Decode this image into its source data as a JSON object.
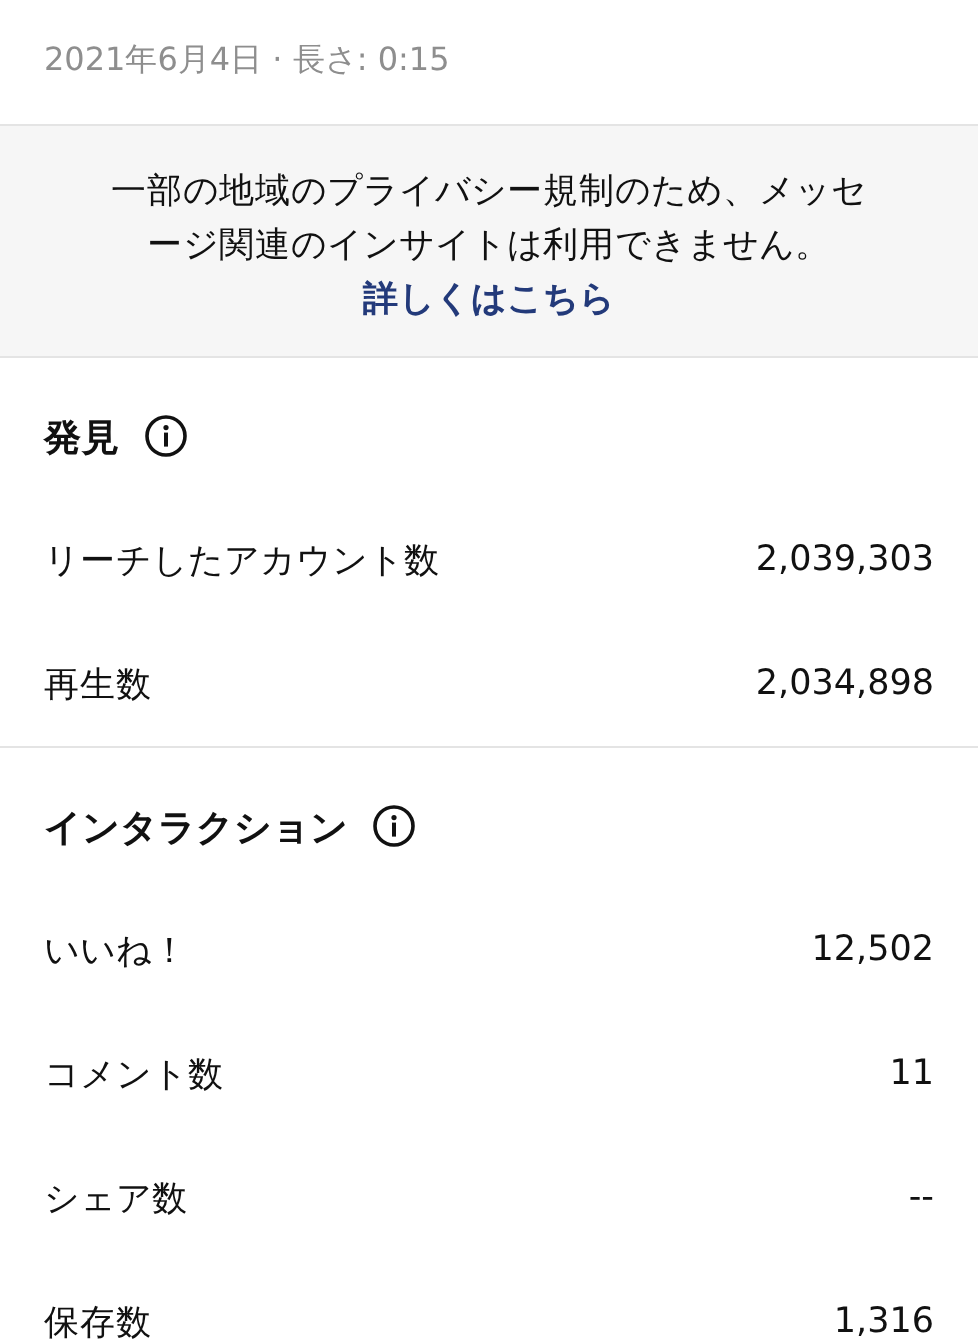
{
  "date_line": "2021年6月4日 · 長さ: 0:15",
  "notice": {
    "text": "一部の地域のプライバシー規制のため、メッセージ関連のインサイトは利用できません。",
    "link": "詳しくはこちら"
  },
  "sections": [
    {
      "title": "発見",
      "info_icon": true,
      "rows": [
        {
          "label": "リーチしたアカウント数",
          "value": "2,039,303"
        },
        {
          "label": "再生数",
          "value": "2,034,898"
        }
      ]
    },
    {
      "title": "インタラクション",
      "info_icon": true,
      "rows": [
        {
          "label": "いいね！",
          "value": "12,502"
        },
        {
          "label": "コメント数",
          "value": "11"
        },
        {
          "label": "シェア数",
          "value": "--"
        },
        {
          "label": "保存数",
          "value": "1,316"
        }
      ]
    }
  ]
}
